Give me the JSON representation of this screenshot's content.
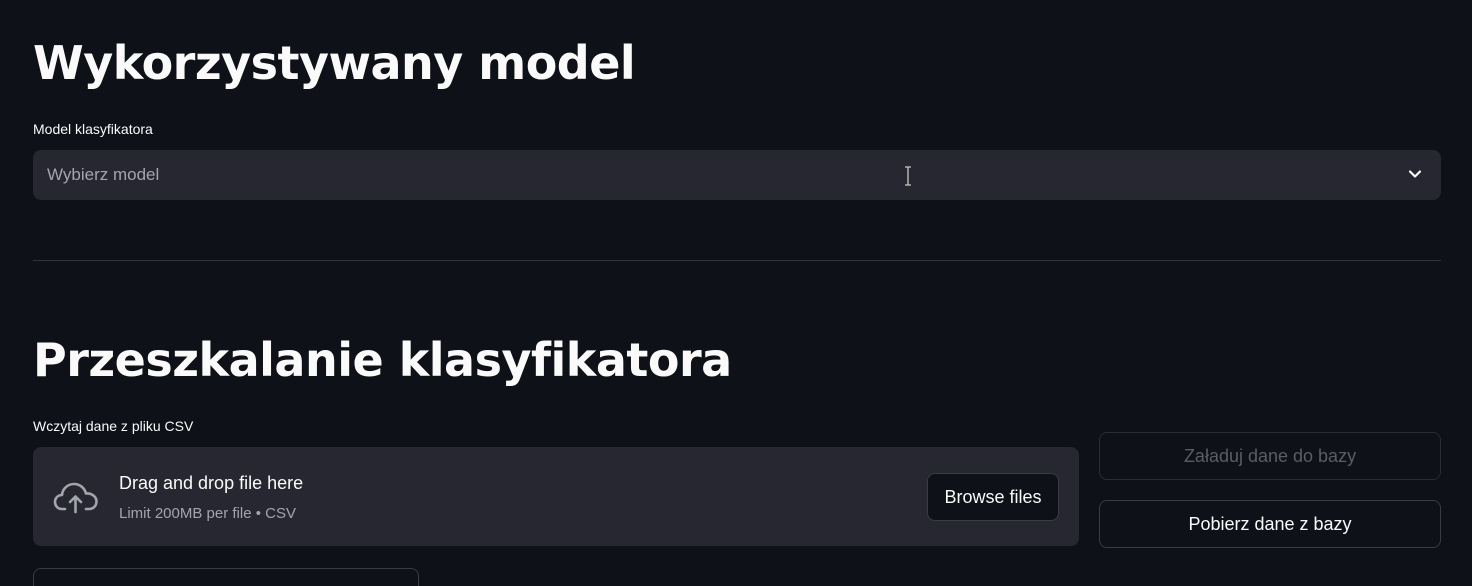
{
  "model_section": {
    "title": "Wykorzystywany model",
    "select_label": "Model klasyfikatora",
    "select_placeholder": "Wybierz model",
    "select_icon": "chevron-down-icon"
  },
  "retrain_section": {
    "title": "Przeszkalanie klasyfikatora",
    "uploader_label": "Wczytaj dane z pliku CSV",
    "dropzone_text": "Drag and drop file here",
    "dropzone_limit": "Limit 200MB per file • CSV",
    "dropzone_icon": "cloud-upload-icon",
    "browse_label": "Browse files",
    "upload_db_label": "Załaduj dane do bazy",
    "fetch_db_label": "Pobierz dane z bazy"
  },
  "colors": {
    "background": "#0e1117",
    "input_bg": "#262730",
    "text": "#fafafa",
    "muted_text": "#a3a5ad",
    "disabled_text": "#5b5d66"
  }
}
